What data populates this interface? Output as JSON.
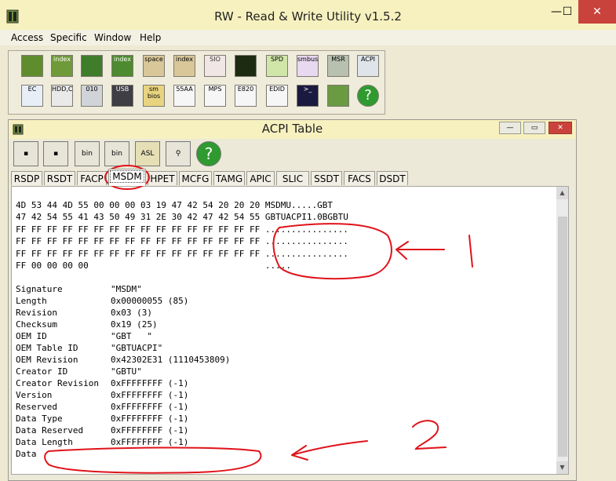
{
  "app": {
    "title": "RW - Read & Write Utility v1.5.2",
    "controls": {
      "minimize": "—",
      "maximize": "☐",
      "close": "✕"
    }
  },
  "menu": [
    "Access",
    "Specific",
    "Window",
    "Help"
  ],
  "toolbar_row1": [
    {
      "icon": "pci-icon",
      "label": ""
    },
    {
      "icon": "index-pci-icon",
      "label": "index"
    },
    {
      "icon": "memory-icon",
      "label": ""
    },
    {
      "icon": "index-memory-icon",
      "label": "index"
    },
    {
      "icon": "io-space-icon",
      "label": "space"
    },
    {
      "icon": "io-index-icon",
      "label": "index"
    },
    {
      "icon": "sio-icon",
      "label": "SIO"
    },
    {
      "icon": "oscilloscope-icon",
      "label": ""
    },
    {
      "icon": "spd-icon",
      "label": "SPD"
    },
    {
      "icon": "smbus-icon",
      "label": "smbus"
    },
    {
      "icon": "msr-icon",
      "label": "MSR"
    },
    {
      "icon": "acpi-icon",
      "label": "ACPI"
    }
  ],
  "toolbar_row2": [
    {
      "icon": "ec-icon",
      "label": "EC"
    },
    {
      "icon": "hdd-cd-icon",
      "label": "HDD,CD"
    },
    {
      "icon": "disk-010-icon",
      "label": "010"
    },
    {
      "icon": "usb-icon",
      "label": "USB"
    },
    {
      "icon": "smbios-icon",
      "label": "sm bios"
    },
    {
      "icon": "55aa-icon",
      "label": "55AA"
    },
    {
      "icon": "mps-icon",
      "label": "MPS"
    },
    {
      "icon": "e820-icon",
      "label": "E820"
    },
    {
      "icon": "edid-icon",
      "label": "EDID"
    },
    {
      "icon": "command-icon",
      "label": ">_"
    },
    {
      "icon": "devices-icon",
      "label": ""
    },
    {
      "icon": "help-icon",
      "label": "?"
    }
  ],
  "inner_window": {
    "title": "ACPI Table",
    "controls": {
      "minimize": "—",
      "restore": "▭",
      "close": "✕"
    },
    "buttons": [
      {
        "icon": "save-icon",
        "label": ""
      },
      {
        "icon": "save-all-icon",
        "label": ""
      },
      {
        "icon": "bin-icon",
        "label": "bin"
      },
      {
        "icon": "bin-multi-icon",
        "label": "bin"
      },
      {
        "icon": "asl-icon",
        "label": "ASL"
      },
      {
        "icon": "binoculars-icon",
        "label": ""
      },
      {
        "icon": "help-icon",
        "label": "?"
      }
    ],
    "tabs": [
      "RSDP",
      "RSDT",
      "FACP",
      "MSDM",
      "HPET",
      "MCFG",
      "TAMG",
      "APIC",
      "SLIC",
      "SSDT",
      "FACS",
      "DSDT"
    ],
    "active_tab": "MSDM"
  },
  "hex_lines": [
    "4D 53 44 4D 55 00 00 00 03 19 47 42 54 20 20 20 MSDMU.....GBT",
    "47 42 54 55 41 43 50 49 31 2E 30 42 47 42 54 55 GBTUACPI1.0BGBTU",
    "FF FF FF FF FF FF FF FF FF FF FF FF FF FF FF FF ................",
    "FF FF FF FF FF FF FF FF FF FF FF FF FF FF FF FF ................",
    "FF FF FF FF FF FF FF FF FF FF FF FF FF FF FF FF ................",
    "FF 00 00 00 00                                  ....."
  ],
  "fields": [
    {
      "name": "Signature",
      "value": "\"MSDM\""
    },
    {
      "name": "Length",
      "value": "0x00000055 (85)"
    },
    {
      "name": "Revision",
      "value": "0x03 (3)"
    },
    {
      "name": "Checksum",
      "value": "0x19 (25)"
    },
    {
      "name": "OEM ID",
      "value": "\"GBT   \""
    },
    {
      "name": "OEM Table ID",
      "value": "\"GBTUACPI\""
    },
    {
      "name": "OEM Revision",
      "value": "0x42302E31 (1110453809)"
    },
    {
      "name": "Creator ID",
      "value": "\"GBTU\""
    },
    {
      "name": "Creator Revision",
      "value": "0xFFFFFFFF (-1)"
    },
    {
      "name": "Version",
      "value": "0xFFFFFFFF (-1)"
    },
    {
      "name": "Reserved",
      "value": "0xFFFFFFFF (-1)"
    },
    {
      "name": "Data Type",
      "value": "0xFFFFFFFF (-1)"
    },
    {
      "name": "Data Reserved",
      "value": "0xFFFFFFFF (-1)"
    },
    {
      "name": "Data Length",
      "value": "0xFFFFFFFF (-1)"
    },
    {
      "name": "Data",
      "value": ""
    }
  ],
  "annotations": {
    "mark1": "1",
    "mark2": "2",
    "color": "#e0131a"
  }
}
